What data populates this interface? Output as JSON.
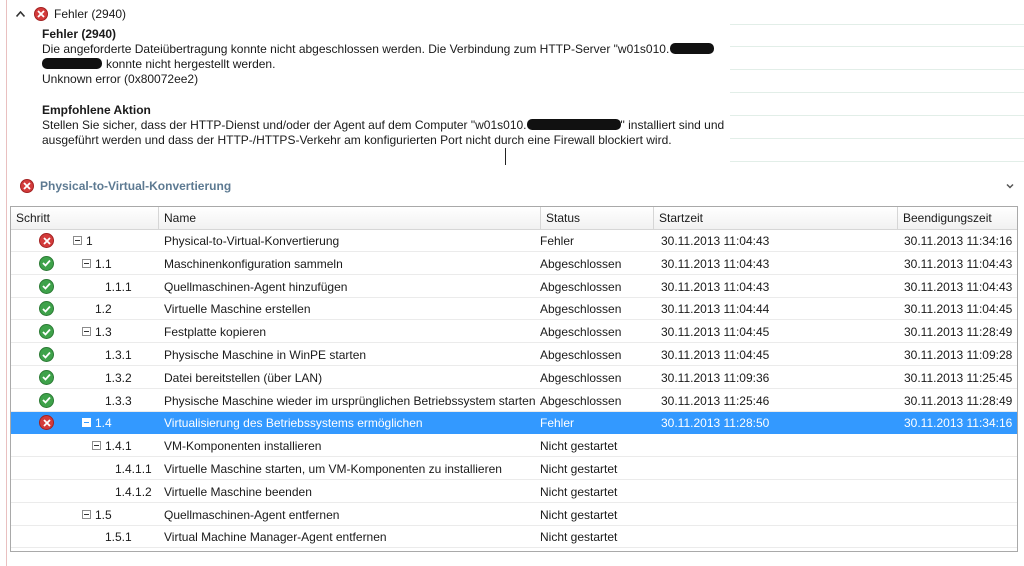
{
  "error_banner": {
    "header": "Fehler (2940)",
    "title": "Fehler (2940)",
    "line1": "Die angeforderte Dateiübertragung konnte nicht abgeschlossen werden. Die Verbindung zum HTTP-Server \"w01s010.",
    "line2": "konnte nicht hergestellt werden.",
    "line3": "Unknown error (0x80072ee2)",
    "action_title": "Empfohlene Aktion",
    "action_line1_a": "Stellen Sie sicher, dass der HTTP-Dienst und/oder der Agent auf dem Computer \"w01s010.",
    "action_line1_b": "\" installiert sind und",
    "action_line2": "ausgeführt werden und dass der HTTP-/HTTPS-Verkehr am konfigurierten Port nicht durch eine Firewall blockiert wird."
  },
  "section": {
    "title": "Physical-to-Virtual-Konvertierung",
    "icon": "error-icon",
    "expand_icon": "chevron-down-icon"
  },
  "grid": {
    "columns": [
      "Schritt",
      "Name",
      "Status",
      "Startzeit",
      "Beendigungszeit"
    ],
    "rows": [
      {
        "step": "1",
        "name": "Physical-to-Virtual-Konvertierung",
        "status": "Fehler",
        "start": "30.11.2013 11:04:43",
        "end": "30.11.2013 11:34:16",
        "icon": "error",
        "level": 0,
        "expander": true,
        "selected": false
      },
      {
        "step": "1.1",
        "name": "Maschinenkonfiguration sammeln",
        "status": "Abgeschlossen",
        "start": "30.11.2013 11:04:43",
        "end": "30.11.2013 11:04:43",
        "icon": "success",
        "level": 1,
        "expander": true,
        "selected": false
      },
      {
        "step": "1.1.1",
        "name": "Quellmaschinen-Agent hinzufügen",
        "status": "Abgeschlossen",
        "start": "30.11.2013 11:04:43",
        "end": "30.11.2013 11:04:43",
        "icon": "success",
        "level": 2,
        "expander": false,
        "selected": false
      },
      {
        "step": "1.2",
        "name": "Virtuelle Maschine erstellen",
        "status": "Abgeschlossen",
        "start": "30.11.2013 11:04:44",
        "end": "30.11.2013 11:04:45",
        "icon": "success",
        "level": 1,
        "expander": false,
        "selected": false
      },
      {
        "step": "1.3",
        "name": "Festplatte kopieren",
        "status": "Abgeschlossen",
        "start": "30.11.2013 11:04:45",
        "end": "30.11.2013 11:28:49",
        "icon": "success",
        "level": 1,
        "expander": true,
        "selected": false
      },
      {
        "step": "1.3.1",
        "name": "Physische Maschine in WinPE starten",
        "status": "Abgeschlossen",
        "start": "30.11.2013 11:04:45",
        "end": "30.11.2013 11:09:28",
        "icon": "success",
        "level": 2,
        "expander": false,
        "selected": false
      },
      {
        "step": "1.3.2",
        "name": "Datei bereitstellen (über LAN)",
        "status": "Abgeschlossen",
        "start": "30.11.2013 11:09:36",
        "end": "30.11.2013 11:25:45",
        "icon": "success",
        "level": 2,
        "expander": false,
        "selected": false
      },
      {
        "step": "1.3.3",
        "name": "Physische Maschine wieder im ursprünglichen Betriebssystem starten",
        "status": "Abgeschlossen",
        "start": "30.11.2013 11:25:46",
        "end": "30.11.2013 11:28:49",
        "icon": "success",
        "level": 2,
        "expander": false,
        "selected": false
      },
      {
        "step": "1.4",
        "name": "Virtualisierung des Betriebssystems ermöglichen",
        "status": "Fehler",
        "start": "30.11.2013 11:28:50",
        "end": "30.11.2013 11:34:16",
        "icon": "error",
        "level": 1,
        "expander": true,
        "selected": true
      },
      {
        "step": "1.4.1",
        "name": "VM-Komponenten installieren",
        "status": "Nicht gestartet",
        "start": "",
        "end": "",
        "icon": "none",
        "level": 2,
        "expander": true,
        "selected": false
      },
      {
        "step": "1.4.1.1",
        "name": "Virtuelle Maschine starten, um VM-Komponenten zu installieren",
        "status": "Nicht gestartet",
        "start": "",
        "end": "",
        "icon": "none",
        "level": 3,
        "expander": false,
        "selected": false
      },
      {
        "step": "1.4.1.2",
        "name": "Virtuelle Maschine beenden",
        "status": "Nicht gestartet",
        "start": "",
        "end": "",
        "icon": "none",
        "level": 3,
        "expander": false,
        "selected": false
      },
      {
        "step": "1.5",
        "name": "Quellmaschinen-Agent entfernen",
        "status": "Nicht gestartet",
        "start": "",
        "end": "",
        "icon": "none",
        "level": 1,
        "expander": true,
        "selected": false
      },
      {
        "step": "1.5.1",
        "name": "Virtual Machine Manager-Agent entfernen",
        "status": "Nicht gestartet",
        "start": "",
        "end": "",
        "icon": "none",
        "level": 2,
        "expander": false,
        "selected": false
      }
    ]
  },
  "colors": {
    "selection": "#3399ff",
    "error": "#d33b3b",
    "success": "#3ea24a",
    "section_title": "#5d7a92"
  }
}
